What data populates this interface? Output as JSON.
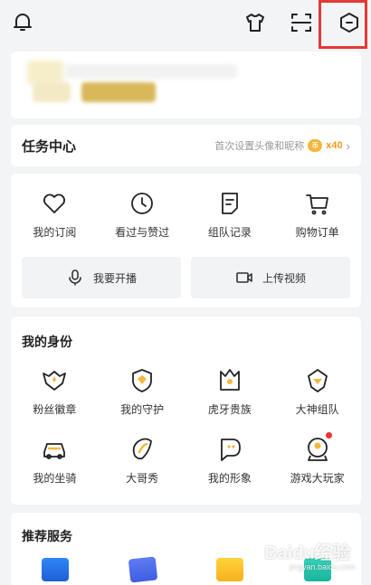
{
  "topbar": {
    "icons": [
      "bell-icon",
      "tshirt-icon",
      "scan-icon",
      "settings-hexagon-icon"
    ]
  },
  "task_center": {
    "title": "任务中心",
    "hint": "首次设置头像和昵称",
    "reward": "x40"
  },
  "quick_actions": [
    {
      "label": "我的订阅",
      "icon": "heart-icon"
    },
    {
      "label": "看过与赞过",
      "icon": "clock-icon"
    },
    {
      "label": "组队记录",
      "icon": "note-icon"
    },
    {
      "label": "购物订单",
      "icon": "cart-icon"
    }
  ],
  "buttons": {
    "live": "我要开播",
    "upload": "上传视频"
  },
  "identity": {
    "title": "我的身份",
    "items": [
      {
        "label": "粉丝徽章",
        "icon": "fan-badge-icon"
      },
      {
        "label": "我的守护",
        "icon": "guard-shield-icon"
      },
      {
        "label": "虎牙贵族",
        "icon": "noble-crown-icon"
      },
      {
        "label": "大神组队",
        "icon": "master-team-icon"
      },
      {
        "label": "我的坐骑",
        "icon": "mount-car-icon"
      },
      {
        "label": "大哥秀",
        "icon": "big-brother-icon"
      },
      {
        "label": "我的形象",
        "icon": "avatar-image-icon"
      },
      {
        "label": "游戏大玩家",
        "icon": "game-player-icon"
      }
    ]
  },
  "recommended": {
    "title": "推荐服务"
  },
  "watermark": {
    "text": "Baidu经验",
    "url": "jingyan.baidu.com"
  },
  "colors": {
    "accent": "#f6b73c",
    "highlight": "#e53935",
    "notification": "#f23030"
  }
}
